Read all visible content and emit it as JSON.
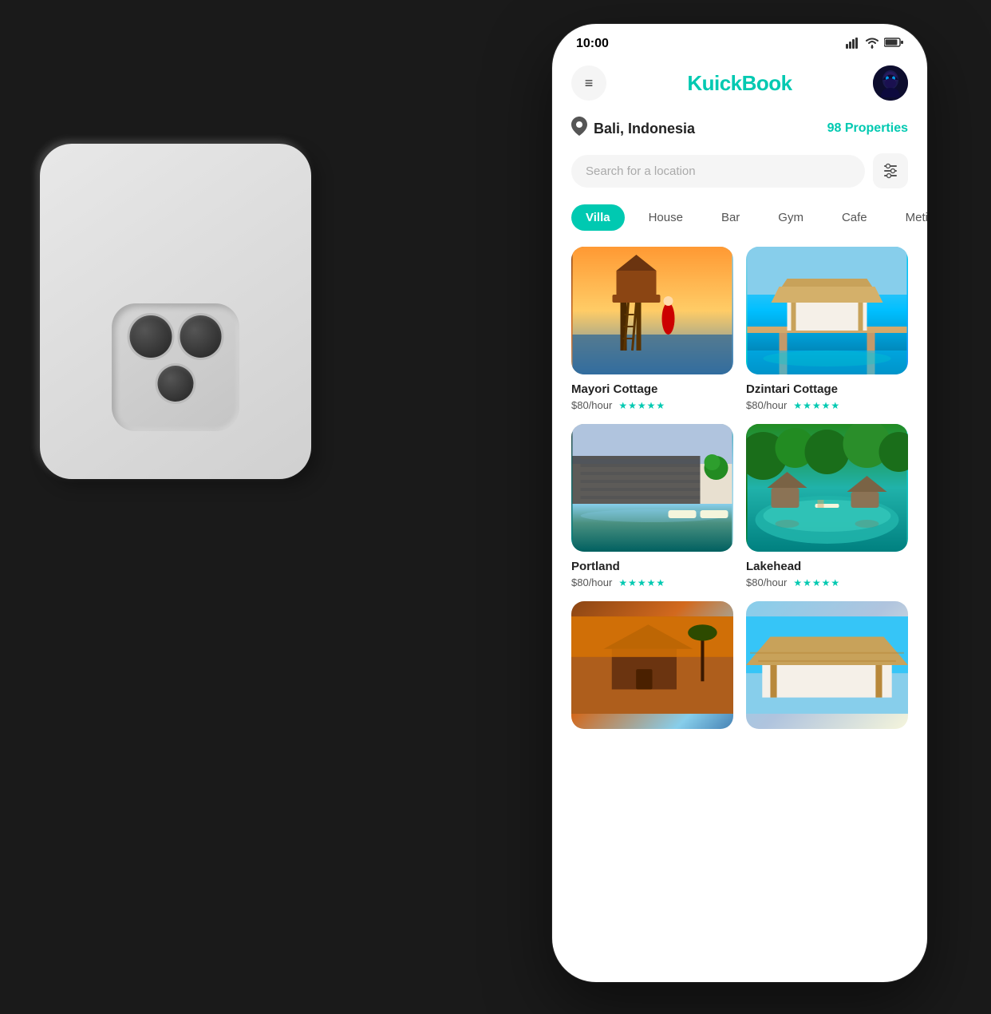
{
  "back_device": {
    "visible": true
  },
  "phone": {
    "status_bar": {
      "time": "10:00",
      "signal": "📶",
      "wifi": "WiFi",
      "battery": "🔋"
    },
    "header": {
      "menu_icon": "≡",
      "app_title": "KuickBook",
      "avatar_emoji": "🧙"
    },
    "location": {
      "pin_icon": "📍",
      "city": "Bali, Indonesia",
      "properties_count": "98",
      "properties_label": "Properties"
    },
    "search": {
      "placeholder": "Search for a location",
      "filter_icon": "⚙"
    },
    "categories": [
      {
        "label": "Villa",
        "active": true
      },
      {
        "label": "House",
        "active": false
      },
      {
        "label": "Bar",
        "active": false
      },
      {
        "label": "Gym",
        "active": false
      },
      {
        "label": "Cafe",
        "active": false
      },
      {
        "label": "Meting",
        "active": false
      }
    ],
    "properties": [
      {
        "name": "Mayori Cottage",
        "price": "$80/hour",
        "stars": "★★★★★",
        "img_class": "img-mayori"
      },
      {
        "name": "Dzintari Cottage",
        "price": "$80/hour",
        "stars": "★★★★★",
        "img_class": "img-dzintari"
      },
      {
        "name": "Portland",
        "price": "$80/hour",
        "stars": "★★★★★",
        "img_class": "img-portland"
      },
      {
        "name": "Lakehead",
        "price": "$80/hour",
        "stars": "★★★★★",
        "img_class": "img-lakehead"
      }
    ],
    "partial_properties": [
      {
        "img_class": "img-partial1"
      },
      {
        "img_class": "img-partial2"
      }
    ]
  }
}
